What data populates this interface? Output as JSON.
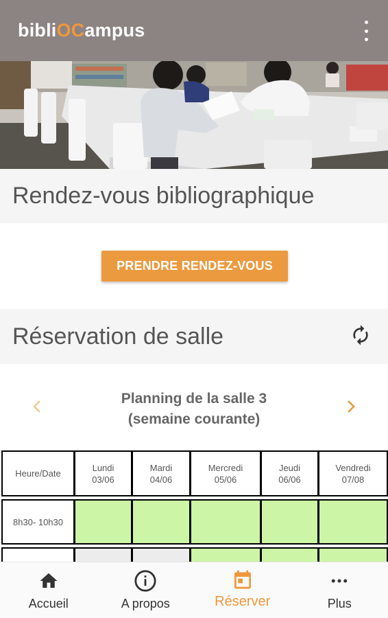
{
  "app": {
    "logo_prefix": "bibli",
    "logo_accent": "OC",
    "logo_suffix": "ampus",
    "accent_color": "#f0973b",
    "appbar_color": "#8c8383"
  },
  "appbar": {
    "menu_icon": "more-vert-icon"
  },
  "hero": {
    "image": "students-studying-in-library-photo"
  },
  "rdv": {
    "title": "Rendez-vous bibliographique",
    "button_label": "PRENDRE RENDEZ-VOUS"
  },
  "reservation": {
    "title": "Réservation de salle",
    "refresh_icon": "refresh-icon",
    "planning_line1": "Planning de la salle 3",
    "planning_line2": "(semaine courante)",
    "prev_icon": "chevron-left-icon",
    "next_icon": "chevron-right-icon"
  },
  "table": {
    "header_label": "Heure/Date",
    "days": [
      {
        "name": "Lundi",
        "date": "03/06"
      },
      {
        "name": "Mardi",
        "date": "04/06"
      },
      {
        "name": "Mercredi",
        "date": "05/06"
      },
      {
        "name": "Jeudi",
        "date": "06/06"
      },
      {
        "name": "Vendredi",
        "date": "07/08"
      }
    ],
    "rows": [
      {
        "time": "8h30- 10h30",
        "status": [
          "available",
          "available",
          "available",
          "available",
          "available"
        ]
      },
      {
        "time": "",
        "status": [
          "unavailable",
          "unavailable",
          "available",
          "available",
          "available"
        ]
      }
    ],
    "available_color": "#ccf5a6",
    "unavailable_color": "#ececec"
  },
  "bottom_nav": [
    {
      "label": "Accueil",
      "icon": "home-icon"
    },
    {
      "label": "A propos",
      "icon": "info-icon"
    },
    {
      "label": "Réserver",
      "icon": "calendar-icon",
      "active": true
    },
    {
      "label": "Plus",
      "icon": "more-horiz-icon"
    }
  ]
}
